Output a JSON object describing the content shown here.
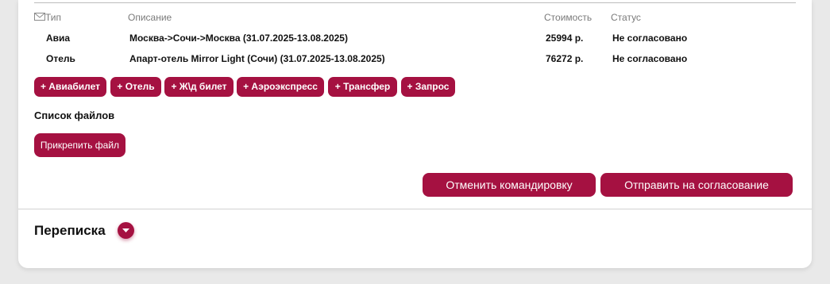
{
  "table": {
    "headers": {
      "type": "Тип",
      "description": "Описание",
      "cost": "Стоимость",
      "status": "Статус"
    },
    "rows": [
      {
        "type": "Авиа",
        "description": "Москва->Сочи->Москва (31.07.2025-13.08.2025)",
        "cost": "25994 р.",
        "status": "Не согласовано"
      },
      {
        "type": "Отель",
        "description": "Апарт-отель Mirror Light (Сочи) (31.07.2025-13.08.2025)",
        "cost": "76272 р.",
        "status": "Не согласовано"
      }
    ]
  },
  "add_buttons": [
    "+ Авиабилет",
    "+ Отель",
    "+ Ж\\д билет",
    "+ Аэроэкспресс",
    "+ Трансфер",
    "+ Запрос"
  ],
  "files": {
    "title": "Список файлов",
    "attach_label": "Прикрепить файл"
  },
  "actions": {
    "cancel_label": "Отменить командировку",
    "submit_label": "Отправить на согласование"
  },
  "correspondence": {
    "title": "Переписка",
    "toggle_icon": "chevron-down-icon"
  },
  "colors": {
    "accent": "#a51141",
    "background": "#e9e9e9",
    "card": "#ffffff"
  }
}
